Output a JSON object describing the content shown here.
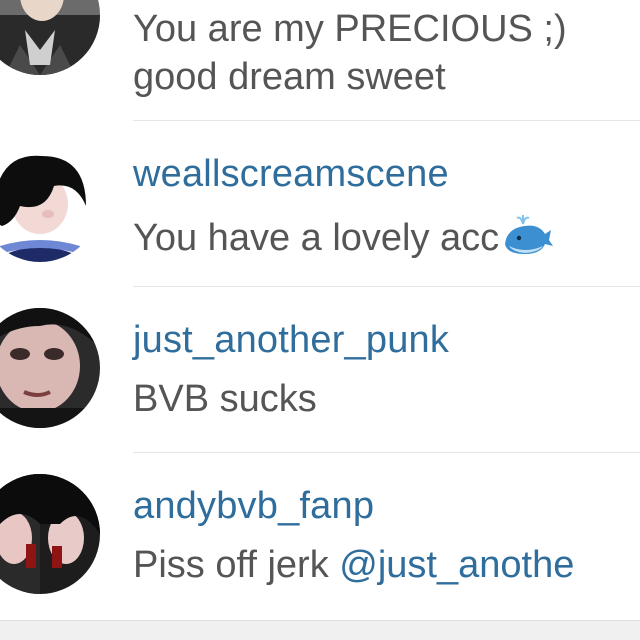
{
  "comments": [
    {
      "username": "",
      "text_line1": "You are my PRECIOUS ;)",
      "text_line2": "good dream sweet",
      "avatar_icon": "user-avatar-icon"
    },
    {
      "username": "weallscreamscene",
      "text": "You have a lovely acc",
      "emoji": "whale-icon",
      "avatar_icon": "user-avatar-icon"
    },
    {
      "username": "just_another_punk",
      "text": "BVB sucks",
      "avatar_icon": "user-avatar-icon"
    },
    {
      "username": "andybvb_fanp",
      "text": "Piss off jerk ",
      "mention": "@just_anothe",
      "avatar_icon": "user-avatar-icon"
    }
  ],
  "colors": {
    "username": "#2f6d9c",
    "text": "#555555",
    "divider": "#e6e6e6"
  }
}
